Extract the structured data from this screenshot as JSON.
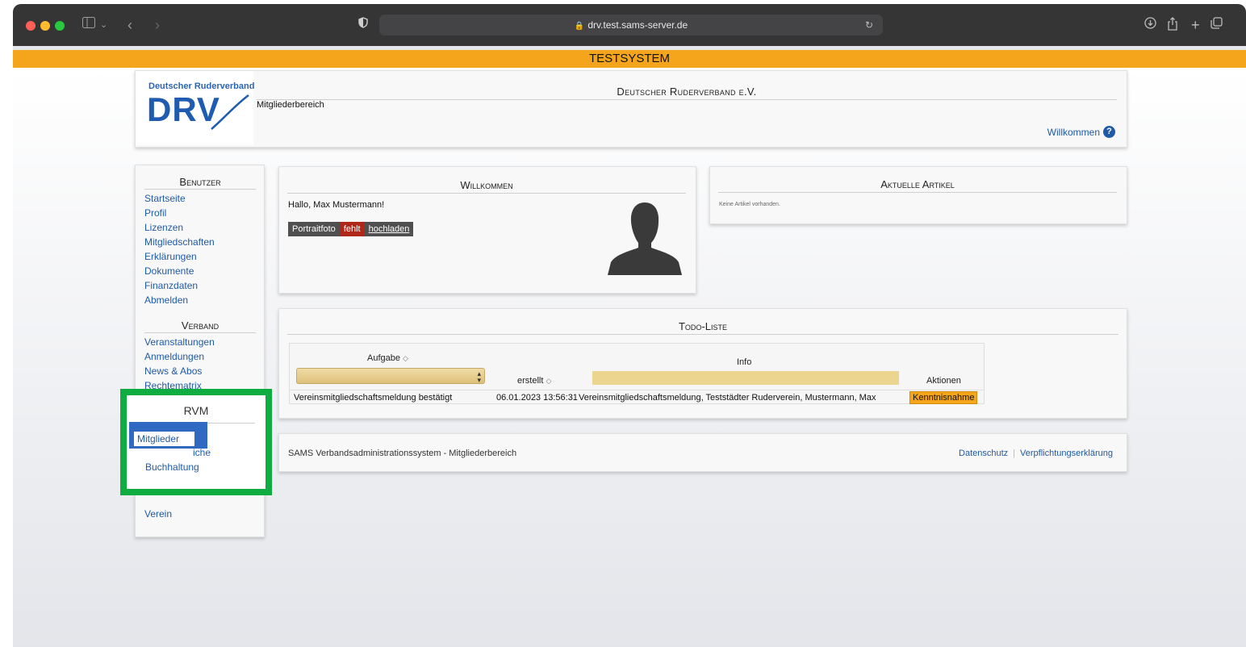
{
  "browser": {
    "url": "drv.test.sams-server.de"
  },
  "banner": "TESTSYSTEM",
  "header": {
    "logo_top": "Deutscher Ruderverband",
    "logo_letters": "DRV",
    "title": "Deutscher Ruderverband e.V.",
    "subtitle": "Mitgliederbereich",
    "welcome_link": "Willkommen",
    "help_glyph": "?"
  },
  "sidebar": {
    "benutzer": {
      "heading": "Benutzer",
      "items": [
        "Startseite",
        "Profil",
        "Lizenzen",
        "Mitgliedschaften",
        "Erklärungen",
        "Dokumente",
        "Finanzdaten",
        "Abmelden"
      ]
    },
    "verband": {
      "heading": "Verband",
      "items": [
        "Veranstaltungen",
        "Anmeldungen",
        "News & Abos",
        "Rechtematrix"
      ]
    },
    "rvm": {
      "heading": "RVM",
      "items": [
        "Mitglieder",
        "Buchhaltung"
      ],
      "partial_item": "iche"
    },
    "verein": {
      "items": [
        "Verein"
      ]
    }
  },
  "welcome_panel": {
    "heading": "Willkommen",
    "greeting": "Hallo, Max Mustermann!",
    "photo_label": "Portraitfoto",
    "photo_status": "fehlt",
    "photo_action": "hochladen"
  },
  "articles_panel": {
    "heading": "Aktuelle Artikel",
    "empty_text": "Keine Artikel vorhanden."
  },
  "todo": {
    "heading": "Todo-Liste",
    "columns": {
      "task": "Aufgabe",
      "created": "erstellt",
      "info": "Info",
      "actions": "Aktionen"
    },
    "rows": [
      {
        "task": "Vereinsmitgliedschaftsmeldung bestätigt",
        "created": "06.01.2023 13:56:31",
        "info": "Vereinsmitgliedschaftsmeldung, Teststädter Ruderverein, Mustermann, Max",
        "action": "Kenntnisnahme"
      }
    ]
  },
  "footer": {
    "text": "SAMS Verbandsadministrationssystem - Mitgliederbereich",
    "links": [
      "Datenschutz",
      "Verpflichtungserklärung"
    ]
  },
  "colors": {
    "banner": "#f5a51c",
    "link": "#1f5aa6",
    "highlight_frame": "#0fad41",
    "highlight_button": "#2f69c2",
    "status_missing": "#b0271a"
  }
}
